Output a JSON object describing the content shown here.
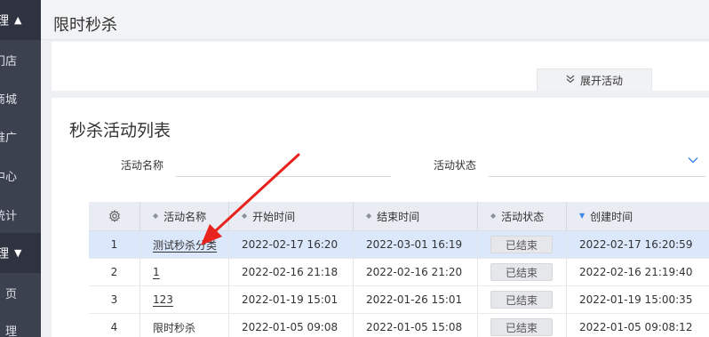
{
  "sidebar": {
    "groups": [
      {
        "label": "理",
        "caret": "▲"
      },
      {
        "label": "理",
        "caret": "▼"
      }
    ],
    "items": [
      {
        "label": "门店"
      },
      {
        "label": "商城"
      },
      {
        "label": "推广"
      },
      {
        "label": "中心"
      },
      {
        "label": "统计"
      },
      {
        "label": "页"
      },
      {
        "label": "理"
      }
    ]
  },
  "header": {
    "title": "限时秒杀"
  },
  "filter_panel": {
    "expand_label": "展开活动",
    "expand_icon": "chevron-double-down"
  },
  "list": {
    "title": "秒杀活动列表",
    "filters": {
      "name_label": "活动名称",
      "status_label": "活动状态"
    },
    "columns": {
      "index_icon": "gear",
      "name": "活动名称",
      "start": "开始时间",
      "end": "结束时间",
      "status": "活动状态",
      "created": "创建时间"
    },
    "rows": [
      {
        "index": "1",
        "name": "测试秒杀分类",
        "start": "2022-02-17 16:20",
        "end": "2022-03-01 16:19",
        "status": "已结束",
        "created": "2022-02-17 16:20:59"
      },
      {
        "index": "2",
        "name": "1",
        "start": "2022-02-16 21:18",
        "end": "2022-02-16 21:20",
        "status": "已结束",
        "created": "2022-02-16 21:19:40"
      },
      {
        "index": "3",
        "name": "123",
        "start": "2022-01-19 15:01",
        "end": "2022-01-26 15:01",
        "status": "已结束",
        "created": "2022-01-19 15:00:35"
      },
      {
        "index": "4",
        "name": "限时秒杀",
        "start": "2022-01-05 09:08",
        "end": "2022-01-05 15:08",
        "status": "已结束",
        "created": "2022-01-05 09:08:12"
      }
    ]
  },
  "colors": {
    "sidebar_bg": "#3c4150",
    "selected_row": "#dbe7fb",
    "arrow": "#e8231d",
    "sort_active": "#3a86e8"
  }
}
